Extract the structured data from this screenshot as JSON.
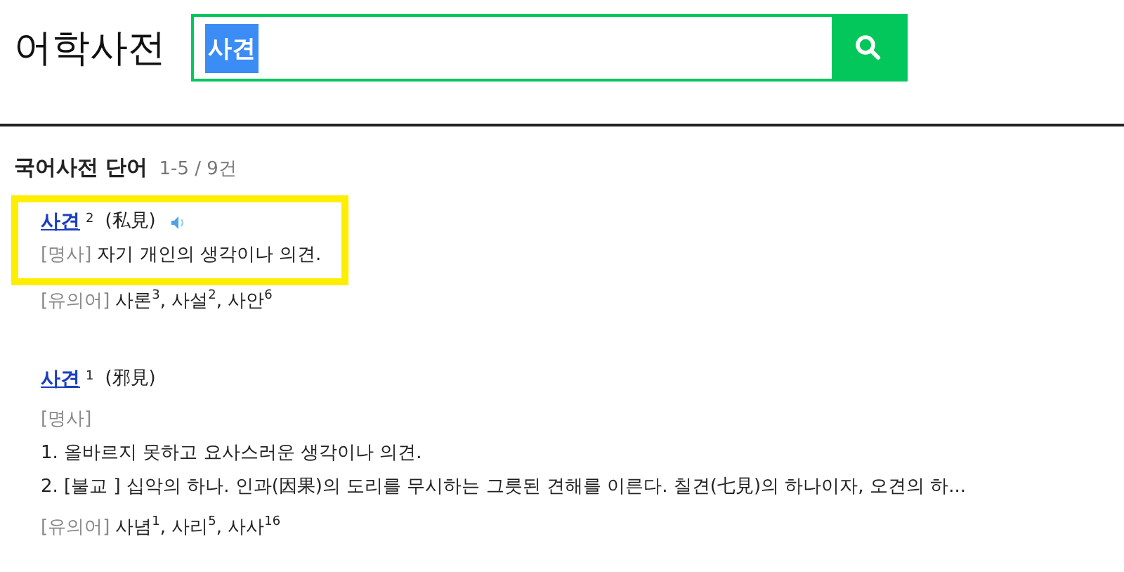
{
  "title": "어학사전",
  "search": {
    "value": "사견",
    "selected": true
  },
  "section": {
    "title": "국어사전 단어",
    "count": "1-5 / 9건"
  },
  "entries": [
    {
      "word": "사견",
      "homonym": "2",
      "hanja": "(私見)",
      "audio": true,
      "highlighted": true,
      "pos": "[명사]",
      "definition": "자기 개인의 생각이나 의견.",
      "synonym_label": "[유의어]",
      "synonyms": "사론$^{3}$, 사설$^{2}$, 사안$^{6}$"
    },
    {
      "word": "사견",
      "homonym": "1",
      "hanja": "(邪見)",
      "pos": "[명사]",
      "senses": [
        "1. 올바르지 못하고 요사스러운 생각이나 의견.",
        "2. [불교 ] 십악의 하나. 인과(因果)의 도리를 무시하는 그릇된 견해를 이른다. 칠견(七見)의 하나이자, 오견의 하..."
      ],
      "synonym_label": "[유의어]",
      "synonyms": "사념$^{1}$, 사리$^{5}$, 사사$^{16}$"
    }
  ]
}
